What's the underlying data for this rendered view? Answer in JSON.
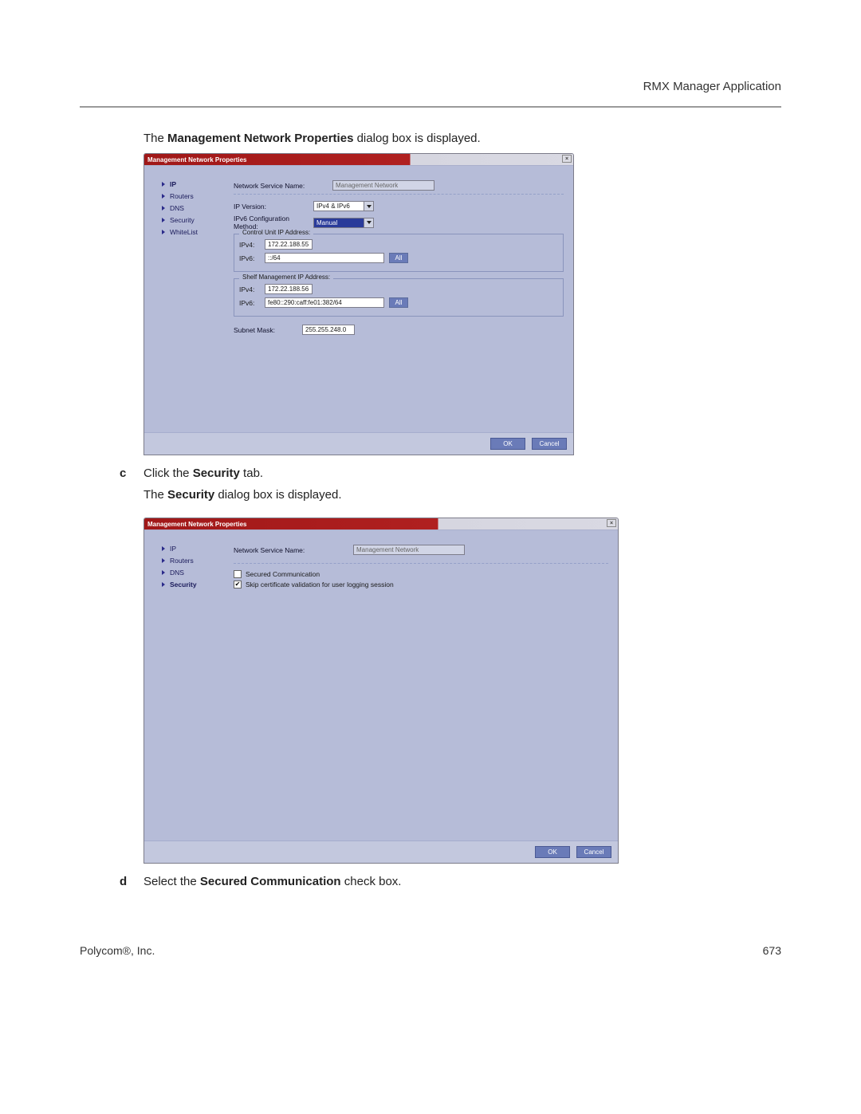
{
  "header": {
    "running_title": "RMX Manager Application"
  },
  "intro": {
    "line1_pre": "The ",
    "line1_bold": "Management Network Properties",
    "line1_post": " dialog box is displayed."
  },
  "dialog1": {
    "title": "Management Network Properties",
    "close_glyph": "×",
    "nav": {
      "items": [
        {
          "label": "IP",
          "active": true
        },
        {
          "label": "Routers"
        },
        {
          "label": "DNS"
        },
        {
          "label": "Security"
        },
        {
          "label": "WhiteList"
        }
      ]
    },
    "content": {
      "svc_name_label": "Network Service Name:",
      "svc_name_value": "Management Network",
      "ip_version_label": "IP Version:",
      "ip_version_value": "IPv4 & IPv6",
      "ipv6_method_label": "IPv6 Configuration Method:",
      "ipv6_method_value": "Manual",
      "fs1": {
        "legend": "Control Unit IP Address:",
        "ipv4_label": "IPv4:",
        "ipv4_value": "172.22.188.55",
        "ipv6_label": "IPv6:",
        "ipv6_value": "::/64",
        "all_btn": "All"
      },
      "fs2": {
        "legend": "Shelf Management IP Address:",
        "ipv4_label": "IPv4:",
        "ipv4_value": "172.22.188.56",
        "ipv6_label": "IPv6:",
        "ipv6_value": "fe80::290:caff:fe01:382/64",
        "all_btn": "All"
      },
      "subnet_label": "Subnet Mask:",
      "subnet_value": "255.255.248.0"
    },
    "buttons": {
      "ok": "OK",
      "cancel": "Cancel"
    }
  },
  "step_c": {
    "letter": "c",
    "line1_pre": "Click the ",
    "line1_bold": "Security",
    "line1_post": " tab.",
    "line2_pre": "The ",
    "line2_bold": "Security",
    "line2_post": " dialog box is displayed."
  },
  "dialog2": {
    "title": "Management Network Properties",
    "close_glyph": "×",
    "nav": {
      "items": [
        {
          "label": "IP"
        },
        {
          "label": "Routers"
        },
        {
          "label": "DNS"
        },
        {
          "label": "Security",
          "active": true
        }
      ]
    },
    "content": {
      "svc_name_label": "Network Service Name:",
      "svc_name_value": "Management Network",
      "cb1_label": "Secured Communication",
      "cb1_checked": false,
      "cb2_label": "Skip certificate validation for user logging session",
      "cb2_checked": true,
      "check_glyph": "✔"
    },
    "buttons": {
      "ok": "OK",
      "cancel": "Cancel"
    }
  },
  "step_d": {
    "letter": "d",
    "line_pre": "Select the ",
    "line_bold": "Secured Communication",
    "line_post": " check box."
  },
  "footer": {
    "left": "Polycom®, Inc.",
    "right": "673"
  }
}
